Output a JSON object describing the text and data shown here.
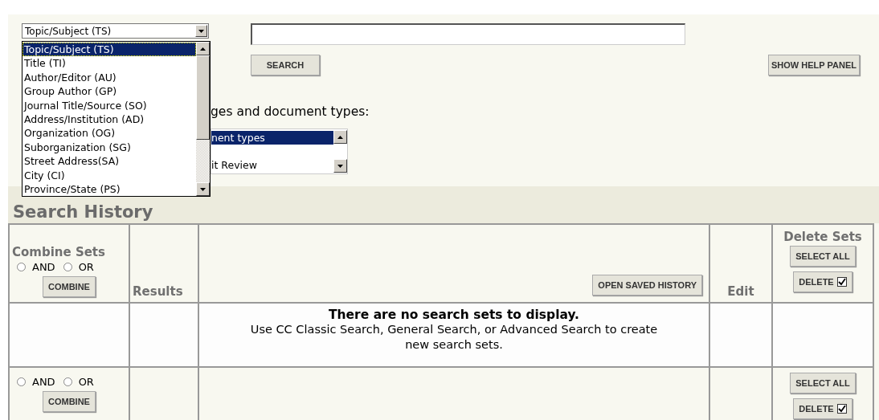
{
  "field_select": {
    "value": "Topic/Subject (TS)",
    "expanded": true,
    "options": [
      {
        "label": "Topic/Subject (TS)",
        "selected": true
      },
      {
        "label": "Title (TI)",
        "selected": false
      },
      {
        "label": "Author/Editor (AU)",
        "selected": false
      },
      {
        "label": "Group Author (GP)",
        "selected": false
      },
      {
        "label": "Journal Title/Source (SO)",
        "selected": false
      },
      {
        "label": "Address/Institution (AD)",
        "selected": false
      },
      {
        "label": "Organization (OG)",
        "selected": false
      },
      {
        "label": "Suborganization (SG)",
        "selected": false
      },
      {
        "label": "Street Address(SA)",
        "selected": false
      },
      {
        "label": "City (CI)",
        "selected": false
      },
      {
        "label": "Province/State (PS)",
        "selected": false
      }
    ]
  },
  "search_button": "SEARCH",
  "help_button": "SHOW HELP PANEL",
  "restrict_text": "ges and document types:",
  "doc_types": [
    {
      "label": "nent types",
      "selected": true
    },
    {
      "label": "it Review",
      "selected": false
    }
  ],
  "history": {
    "title": "Search History",
    "columns": {
      "combine": "Combine Sets",
      "results": "Results",
      "edit": "Edit",
      "delete": "Delete Sets"
    },
    "open_saved": "OPEN SAVED HISTORY",
    "top_controls": {
      "radios": [
        {
          "label": "AND",
          "selected": false
        },
        {
          "label": "OR",
          "selected": false
        }
      ],
      "combine": "COMBINE",
      "select_all": "SELECT ALL",
      "delete": "DELETE",
      "delete_checked": true
    },
    "empty_title": "There are no search sets to display.",
    "empty_text": "Use CC Classic Search, General Search, or Advanced Search to create new search sets.",
    "bottom_controls": {
      "radios": [
        {
          "label": "AND",
          "selected": false
        },
        {
          "label": "OR",
          "selected": false
        }
      ],
      "combine": "COMBINE",
      "select_all": "SELECT ALL",
      "delete": "DELETE",
      "delete_checked": true
    }
  }
}
